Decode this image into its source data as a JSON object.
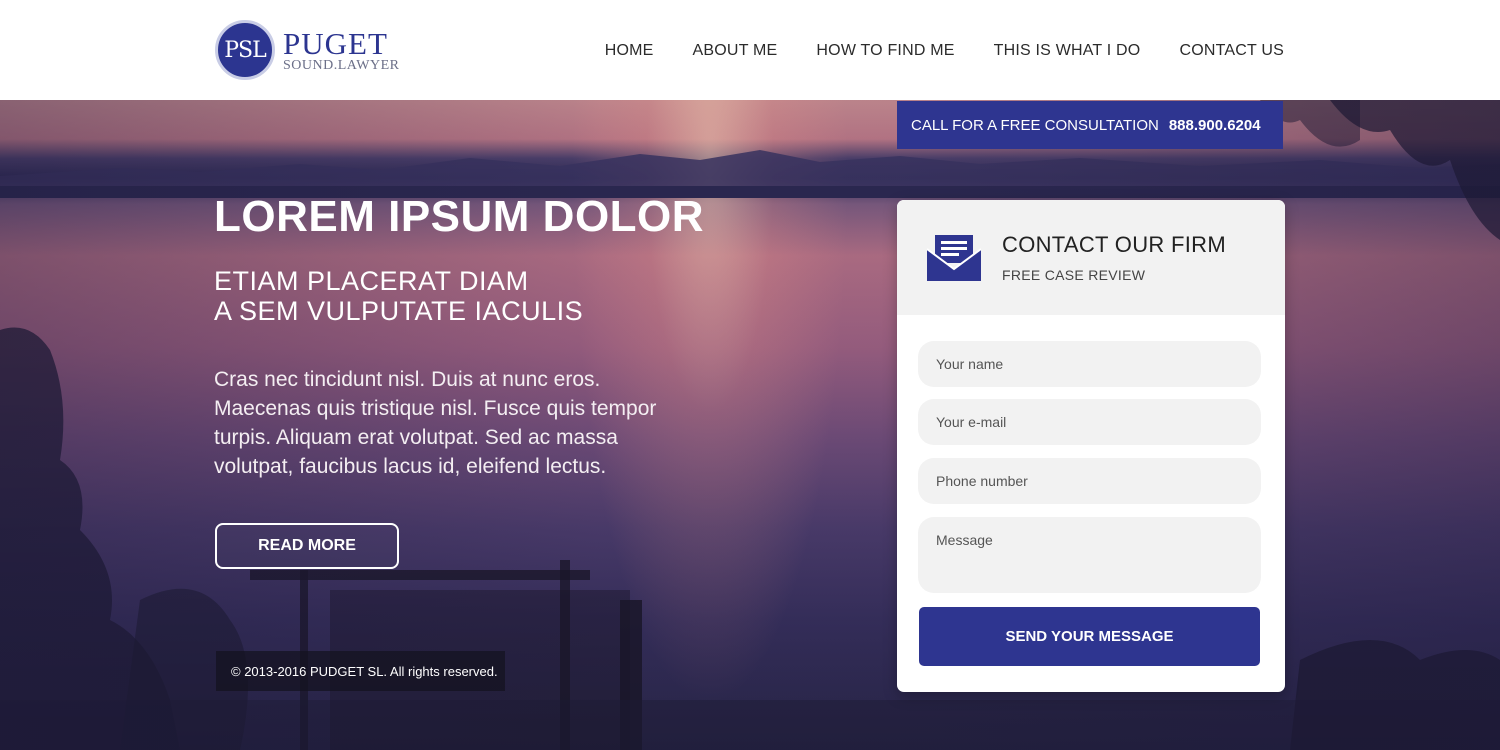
{
  "brand": {
    "logo_mark": "PSL",
    "name": "PUGET",
    "subname": "SOUND.LAWYER",
    "color": "#2e3590"
  },
  "nav": {
    "items": [
      {
        "label": "HOME"
      },
      {
        "label": "ABOUT ME"
      },
      {
        "label": "HOW TO FIND ME"
      },
      {
        "label": "THIS IS WHAT I DO"
      },
      {
        "label": "CONTACT US"
      }
    ]
  },
  "consult": {
    "label": "CALL FOR A FREE CONSULTATION",
    "phone": "888.900.6204"
  },
  "hero": {
    "title": "LOREM IPSUM DOLOR",
    "subtitle_line1": "ETIAM PLACERAT DIAM",
    "subtitle_line2": "A SEM VULPUTATE IACULIS",
    "body": "Cras nec tincidunt nisl. Duis at nunc eros. Maecenas quis tristique nisl. Fusce quis tempor turpis. Aliquam erat volutpat. Sed ac massa volutpat, faucibus lacus id, eleifend lectus.",
    "cta_label": "READ MORE"
  },
  "footer": {
    "copyright": "© 2013-2016 PUDGET SL. All rights reserved."
  },
  "contact_form": {
    "icon": "envelope-icon",
    "title": "CONTACT OUR FIRM",
    "subtitle": "FREE CASE REVIEW",
    "fields": {
      "name_placeholder": "Your name",
      "email_placeholder": "Your e-mail",
      "phone_placeholder": "Phone number",
      "message_placeholder": "Message"
    },
    "submit_label": "SEND YOUR MESSAGE"
  }
}
